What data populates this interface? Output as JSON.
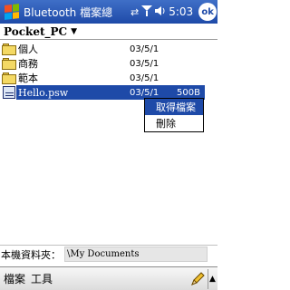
{
  "titlebar": {
    "app_title": "Bluetooth 檔案總",
    "time": "5:03",
    "ok_label": "ok",
    "start_icon": "windows-flag-icon",
    "icons": [
      "sync-icon",
      "signal-icon",
      "volume-icon"
    ]
  },
  "location": {
    "current": "Pocket_PC"
  },
  "files": [
    {
      "name": "個人",
      "date": "03/5/1",
      "size": "",
      "type": "folder"
    },
    {
      "name": "商務",
      "date": "03/5/1",
      "size": "",
      "type": "folder"
    },
    {
      "name": "範本",
      "date": "03/5/1",
      "size": "",
      "type": "folder"
    },
    {
      "name": "Hello.psw",
      "date": "03/5/1",
      "size": "500B",
      "type": "file",
      "selected": true
    }
  ],
  "context_menu": {
    "items": [
      "取得檔案",
      "刪除"
    ]
  },
  "local_folder": {
    "label": "本機資料夾：",
    "value": "\\My Documents"
  },
  "menubar": {
    "menu_label": "檔案",
    "tools_label": "工具"
  },
  "colors": {
    "title_bar": "#1e4aa8",
    "selection": "#1e4aa8",
    "folder": "#f4d964"
  }
}
